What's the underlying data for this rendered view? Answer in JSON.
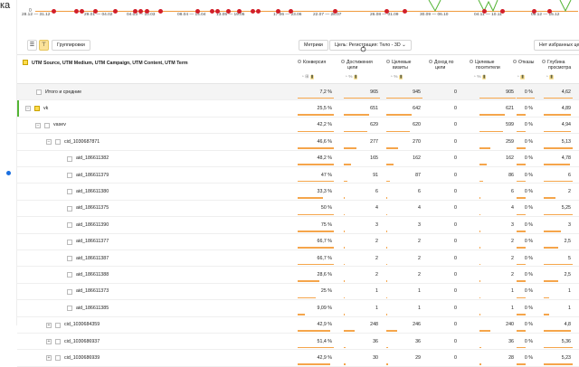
{
  "page": {
    "title_fragment": "ка"
  },
  "chart": {
    "zero_label": "0",
    "date_ticks": [
      "28.12 — 31.12",
      "29.01 — 04.02",
      "04.03 — 10.03",
      "08.04 — 14.04",
      "13.05 — 19.05",
      "17.06 — 23.06",
      "22.07 — 28.07",
      "26.08 — 01.09",
      "30.09 — 06.10",
      "04.11 — 10.11",
      "09.12 — 15.12"
    ],
    "axis_color": "#f19a3d",
    "marker_color": "#d21f2a",
    "line_color": "#54b535"
  },
  "toolbar": {
    "list_icon": "list-icon",
    "tree_icon": "tree-icon",
    "groupings_label": "Группировки",
    "metrics_label": "Метрики",
    "goal_label": "Цель: Регистрация: Тело - 3D",
    "selected_label": "Нет избранных це"
  },
  "header": {
    "dimension_label": "UTM Source, UTM Medium, UTM Campaign, UTM Content, UTM Term",
    "columns": [
      {
        "label": "Конверсия",
        "label2": "",
        "icons": "◔ ⊞ ▮"
      },
      {
        "label": "Достижения",
        "label2": "цели",
        "icons": "◔ % ▮"
      },
      {
        "label": "Целевые",
        "label2": "визиты",
        "icons": "◔ % ▮"
      },
      {
        "label": "Доход по",
        "label2": "цели",
        "icons": ""
      },
      {
        "label": "Целевые",
        "label2": "посетители",
        "icons": "◔ % ▮"
      },
      {
        "label": "Отказы",
        "label2": "",
        "icons": "◔ ▮"
      },
      {
        "label": "Глубина",
        "label2": "просмотра",
        "icons": "◔ ▮"
      }
    ]
  },
  "rows": [
    {
      "name": "Итого и средние",
      "level": 0,
      "type": "total",
      "values": [
        "7,2 %",
        "965",
        "945",
        "0",
        "905",
        "0 %",
        "4,62"
      ],
      "bars": [
        1,
        1,
        1,
        0,
        1,
        1,
        1
      ]
    },
    {
      "name": "vk",
      "level": 0,
      "type": "checked",
      "values": [
        "25,5 %",
        "651",
        "642",
        "0",
        "621",
        "0 %",
        "4,89"
      ],
      "bars": [
        1,
        0.7,
        0.7,
        0,
        0.7,
        0.5,
        0.95
      ]
    },
    {
      "name": "vasev",
      "level": 1,
      "type": "node",
      "values": [
        "42,2 %",
        "629",
        "620",
        "0",
        "599",
        "0 %",
        "4,94"
      ],
      "bars": [
        1,
        0.65,
        0.65,
        0,
        0.65,
        0.5,
        0.95
      ]
    },
    {
      "name": "cid_1030687871",
      "level": 2,
      "type": "node",
      "values": [
        "46,6 %",
        "277",
        "270",
        "0",
        "259",
        "0 %",
        "5,13"
      ],
      "bars": [
        1,
        0.35,
        0.33,
        0,
        0.3,
        0.5,
        1
      ]
    },
    {
      "name": "aid_186611382",
      "level": 3,
      "type": "leaf",
      "values": [
        "48,2 %",
        "165",
        "162",
        "0",
        "162",
        "0 %",
        "4,78"
      ],
      "bars": [
        1,
        0.2,
        0.2,
        0,
        0.2,
        0.5,
        0.9
      ]
    },
    {
      "name": "aid_186611379",
      "level": 3,
      "type": "leaf",
      "values": [
        "47 %",
        "91",
        "87",
        "0",
        "86",
        "0 %",
        "6"
      ],
      "bars": [
        1,
        0.1,
        0.1,
        0,
        0.1,
        0.5,
        1
      ]
    },
    {
      "name": "aid_186611380",
      "level": 3,
      "type": "leaf",
      "values": [
        "33,3 %",
        "6",
        "6",
        "0",
        "6",
        "0 %",
        "2"
      ],
      "bars": [
        0.7,
        0.02,
        0.02,
        0,
        0.02,
        0.5,
        0.4
      ]
    },
    {
      "name": "aid_186611375",
      "level": 3,
      "type": "leaf",
      "values": [
        "50 %",
        "4",
        "4",
        "0",
        "4",
        "0 %",
        "5,25"
      ],
      "bars": [
        1,
        0.02,
        0.02,
        0,
        0.02,
        0.5,
        1
      ]
    },
    {
      "name": "aid_186611390",
      "level": 3,
      "type": "leaf",
      "values": [
        "75 %",
        "3",
        "3",
        "0",
        "3",
        "0 %",
        "3"
      ],
      "bars": [
        1,
        0.02,
        0.02,
        0,
        0.02,
        0.5,
        0.6
      ]
    },
    {
      "name": "aid_186611377",
      "level": 3,
      "type": "leaf",
      "values": [
        "66,7 %",
        "2",
        "2",
        "0",
        "2",
        "0 %",
        "2,5"
      ],
      "bars": [
        1,
        0.02,
        0.02,
        0,
        0.02,
        0.5,
        0.5
      ]
    },
    {
      "name": "aid_186611387",
      "level": 3,
      "type": "leaf",
      "values": [
        "66,7 %",
        "2",
        "2",
        "0",
        "2",
        "0 %",
        "5"
      ],
      "bars": [
        1,
        0.02,
        0.02,
        0,
        0.02,
        0.5,
        1
      ]
    },
    {
      "name": "aid_186611388",
      "level": 3,
      "type": "leaf",
      "values": [
        "28,6 %",
        "2",
        "2",
        "0",
        "2",
        "0 %",
        "2,5"
      ],
      "bars": [
        0.6,
        0.02,
        0.02,
        0,
        0.02,
        0.5,
        0.5
      ]
    },
    {
      "name": "aid_186611373",
      "level": 3,
      "type": "leaf",
      "values": [
        "25 %",
        "1",
        "1",
        "0",
        "1",
        "0 %",
        "1"
      ],
      "bars": [
        0.5,
        0.01,
        0.01,
        0,
        0.01,
        0.5,
        0.2
      ]
    },
    {
      "name": "aid_186611385",
      "level": 3,
      "type": "leaf",
      "values": [
        "9,09 %",
        "1",
        "1",
        "0",
        "1",
        "0 %",
        "1"
      ],
      "bars": [
        0.2,
        0.01,
        0.01,
        0,
        0.01,
        0.5,
        0.2
      ]
    },
    {
      "name": "cid_1030684359",
      "level": 2,
      "type": "collapsed",
      "values": [
        "42,9 %",
        "248",
        "246",
        "0",
        "240",
        "0 %",
        "4,8"
      ],
      "bars": [
        0.9,
        0.3,
        0.3,
        0,
        0.3,
        0.5,
        0.95
      ]
    },
    {
      "name": "cid_1030686937",
      "level": 2,
      "type": "collapsed",
      "values": [
        "51,4 %",
        "36",
        "36",
        "0",
        "36",
        "0 %",
        "5,36"
      ],
      "bars": [
        1,
        0.05,
        0.05,
        0,
        0.05,
        0.5,
        1
      ]
    },
    {
      "name": "cid_1030686939",
      "level": 2,
      "type": "collapsed",
      "values": [
        "42,9 %",
        "30",
        "29",
        "0",
        "28",
        "0 %",
        "5,23"
      ],
      "bars": [
        0.9,
        0.04,
        0.04,
        0,
        0.04,
        0.5,
        1
      ]
    }
  ]
}
